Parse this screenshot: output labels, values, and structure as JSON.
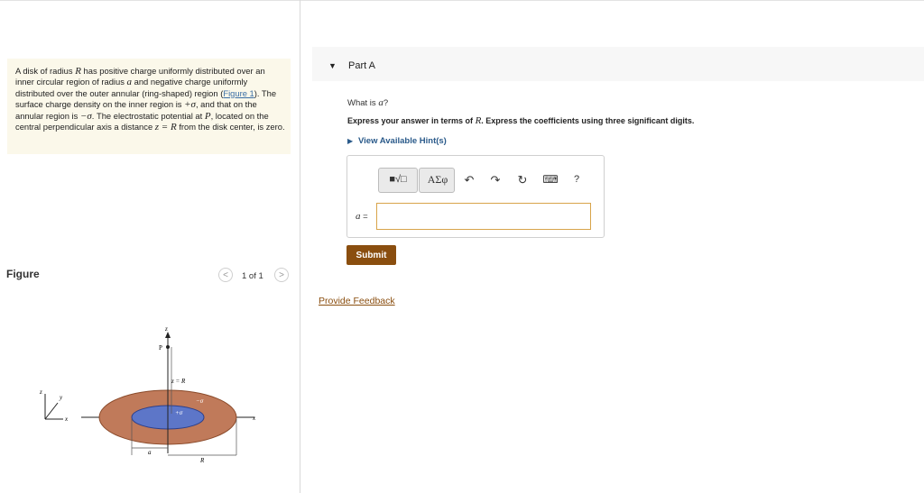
{
  "problem": {
    "seg1": "A disk of radius ",
    "var_R": "R",
    "seg2": " has positive charge uniformly distributed over an inner circular region of radius ",
    "var_a": "a",
    "seg3": " and negative charge uniformly distributed over the outer annular (ring-shaped) region (",
    "figure_link": "Figure 1",
    "seg4": "). The surface charge density on the inner region is ",
    "plus_sigma": "+σ",
    "seg5": ", and that on the annular region is ",
    "minus_sigma": "−σ",
    "seg6": ". The electrostatic potential at ",
    "var_P": "P",
    "seg7": ", located on the central perpendicular axis a distance ",
    "var_eq": "z = R",
    "seg8": " from the disk center, is zero."
  },
  "figure": {
    "label": "Figure",
    "pager": "1 of 1",
    "prev": "<",
    "next": ">",
    "diagram": {
      "z_axis": "z",
      "point_label": "P",
      "height_label": "z = R",
      "neg_label": "−σ",
      "pos_label": "+σ",
      "x_axis": "x",
      "a_dim": "a",
      "R_dim": "R",
      "triad_z": "z",
      "triad_y": "y",
      "triad_x": "x",
      "colors": {
        "outer_ring": "#c07a5a",
        "inner_disk": "#5d76c8"
      }
    }
  },
  "part": {
    "caret": "▼",
    "title": "Part A",
    "question_prefix": "What is ",
    "question_var": "a",
    "question_suffix": "?",
    "instr_prefix": "Express your answer in terms of ",
    "instr_var": "R",
    "instr_suffix": ". Express the coefficients using three significant digits.",
    "hint_caret": "▶",
    "hint_label": "View Available Hint(s)"
  },
  "toolbar": {
    "matrix": "■√□",
    "greek": "ΑΣφ",
    "undo": "↶",
    "redo": "↷",
    "reset": "↻",
    "keyboard": "⌨",
    "help": "?"
  },
  "answer": {
    "label_var": "a",
    "label_eq": " =",
    "value": "",
    "placeholder": ""
  },
  "submit_label": "Submit",
  "feedback_label": "Provide Feedback"
}
